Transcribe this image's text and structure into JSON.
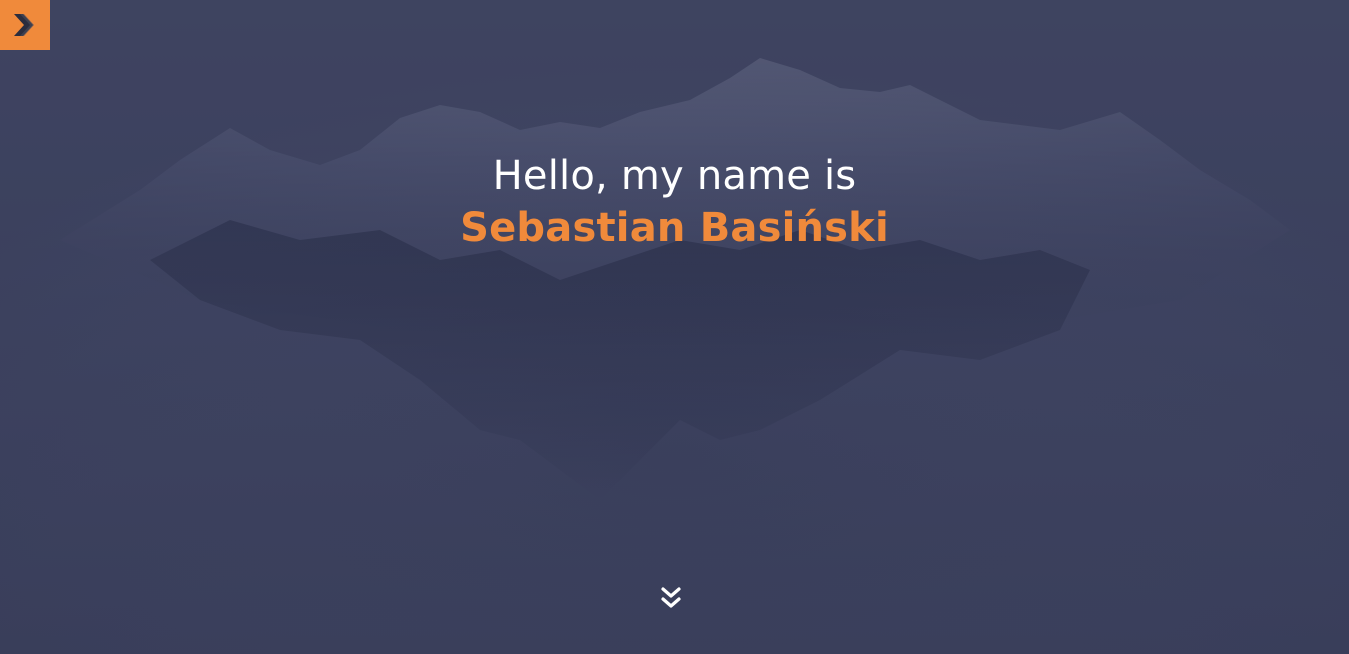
{
  "menu": {
    "icon": "chevron-right-double-icon",
    "accent_color": "#f08a3b"
  },
  "hero": {
    "greeting": "Hello, my name is",
    "name": "Sebastian Basiński",
    "background_color": "#3d4260",
    "name_color": "#f08a3b"
  },
  "scroll": {
    "icon": "double-chevron-down-icon"
  }
}
